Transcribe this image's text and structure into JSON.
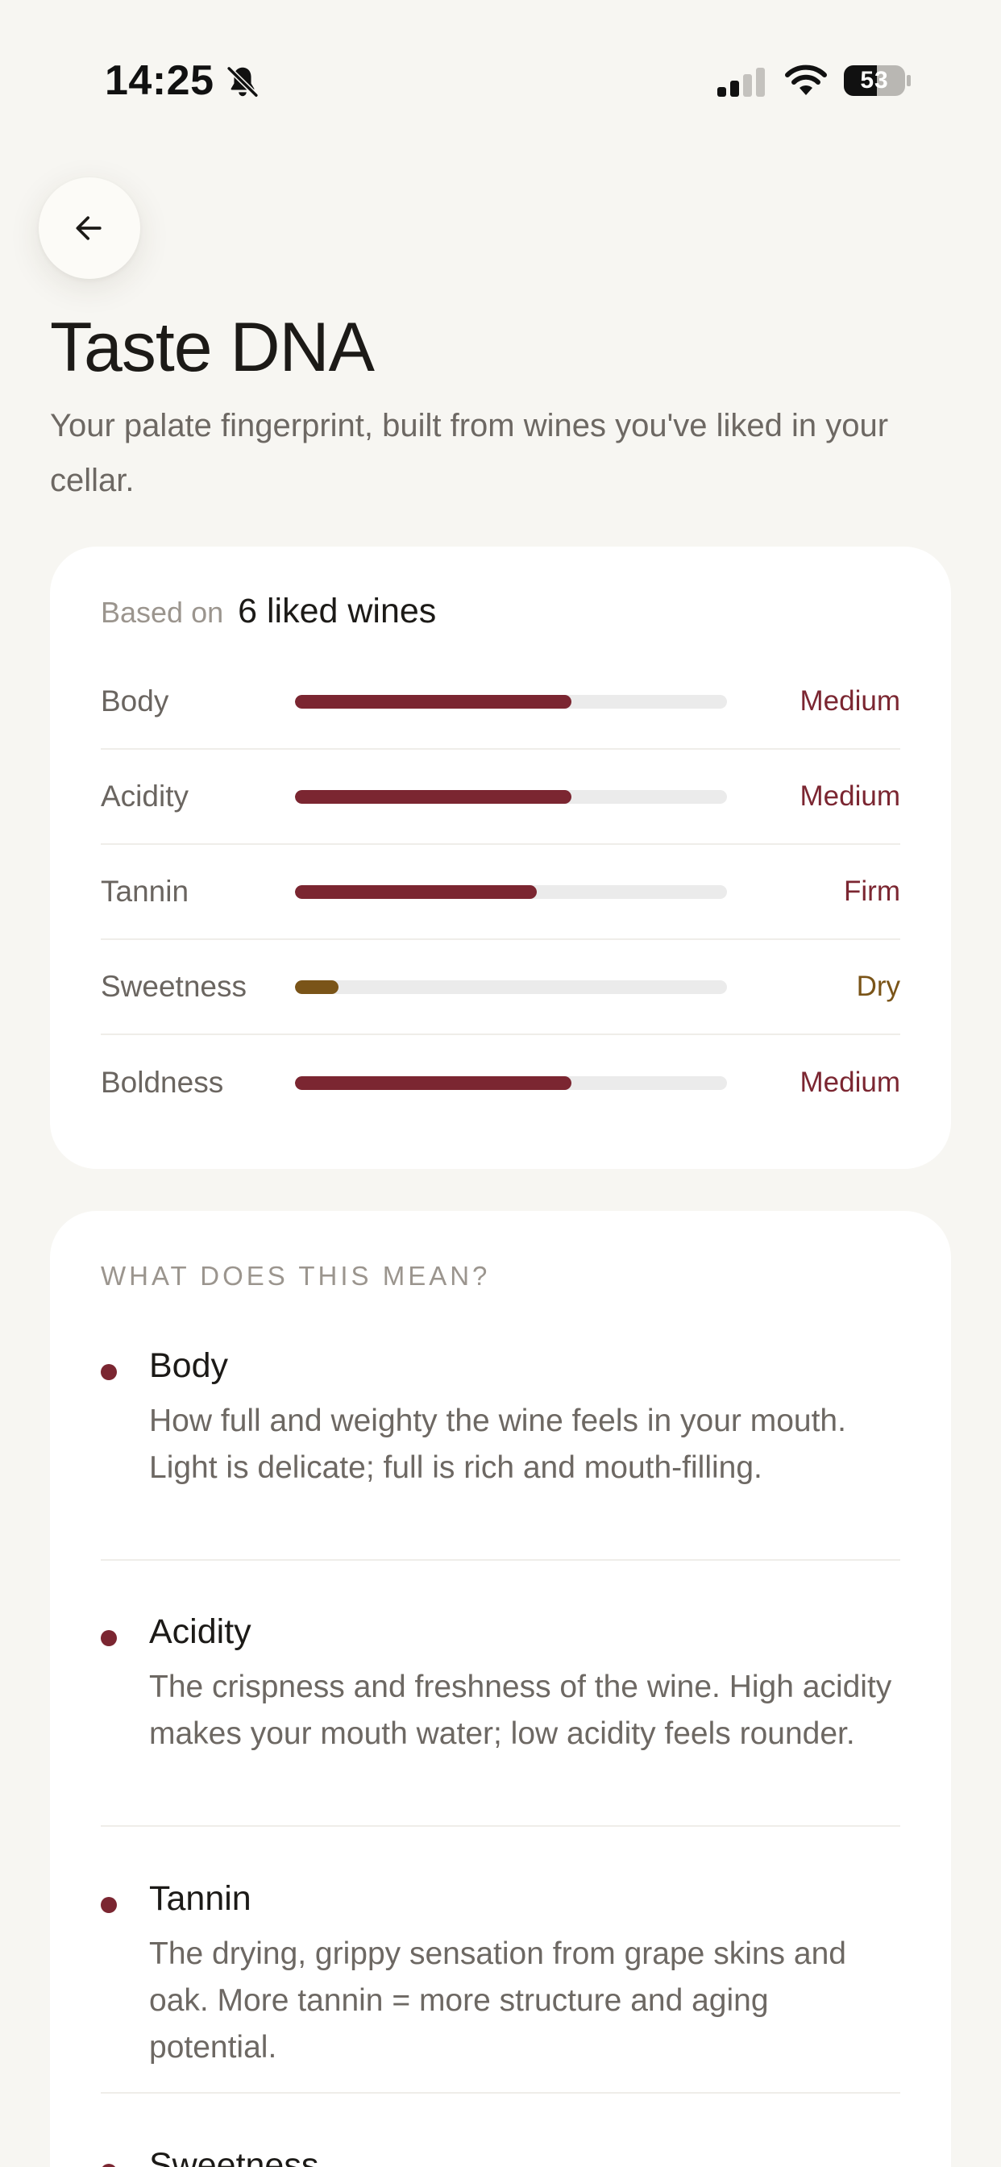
{
  "status_bar": {
    "time": "14:25",
    "battery": "53",
    "icons": [
      "bell-slash-icon",
      "signal-icon",
      "wifi-icon",
      "battery-icon"
    ]
  },
  "header": {
    "back_icon": "arrow-left-icon",
    "title": "Taste DNA",
    "subtitle": "Your palate fingerprint, built from wines you've liked in your cellar."
  },
  "profile": {
    "based_on_label": "Based on",
    "based_on_value": "6 liked wines",
    "traits": [
      {
        "name": "Body",
        "value": "Medium",
        "level": 0.64,
        "color": "#7b2631"
      },
      {
        "name": "Acidity",
        "value": "Medium",
        "level": 0.64,
        "color": "#7b2631"
      },
      {
        "name": "Tannin",
        "value": "Firm",
        "level": 0.56,
        "color": "#7b2631"
      },
      {
        "name": "Sweetness",
        "value": "Dry",
        "level": 0.1,
        "color": "#7a5418"
      },
      {
        "name": "Boldness",
        "value": "Medium",
        "level": 0.64,
        "color": "#7b2631"
      }
    ]
  },
  "meaning": {
    "heading": "WHAT DOES THIS MEAN?",
    "terms": [
      {
        "title": "Body",
        "description": "How full and weighty the wine feels in your mouth. Light is delicate; full is rich and mouth-filling."
      },
      {
        "title": "Acidity",
        "description": "The crispness and freshness of the wine. High acidity makes your mouth water; low acidity feels rounder."
      },
      {
        "title": "Tannin",
        "description": "The drying, grippy sensation from grape skins and oak. More tannin = more structure and aging potential."
      },
      {
        "title": "Sweetness",
        "description": ""
      }
    ]
  },
  "colors": {
    "background": "#f7f6f2",
    "card": "#ffffff",
    "accent_wine": "#7b2631",
    "accent_dry": "#7a5418",
    "muted_text": "#6d6863"
  }
}
